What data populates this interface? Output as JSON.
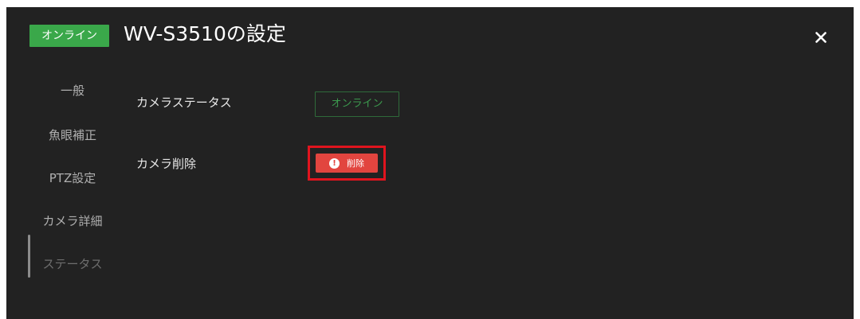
{
  "header": {
    "status_chip": "オンライン",
    "title": "WV-S3510の設定",
    "close_icon": "close-icon"
  },
  "sidebar": {
    "items": [
      {
        "label": "一般",
        "active": false
      },
      {
        "label": "魚眼補正",
        "active": false
      },
      {
        "label": "PTZ設定",
        "active": false
      },
      {
        "label": "カメラ詳細",
        "active": false
      },
      {
        "label": "ステータス",
        "active": true
      }
    ]
  },
  "main": {
    "camera_status_label": "カメラステータス",
    "camera_status_value": "オンライン",
    "camera_delete_label": "カメラ削除",
    "delete_button_label": "削除",
    "delete_button_icon": "alert-icon"
  },
  "colors": {
    "background": "#222222",
    "online_green": "#3aa84a",
    "delete_red": "#e2453f",
    "highlight_red": "#e0141e"
  }
}
